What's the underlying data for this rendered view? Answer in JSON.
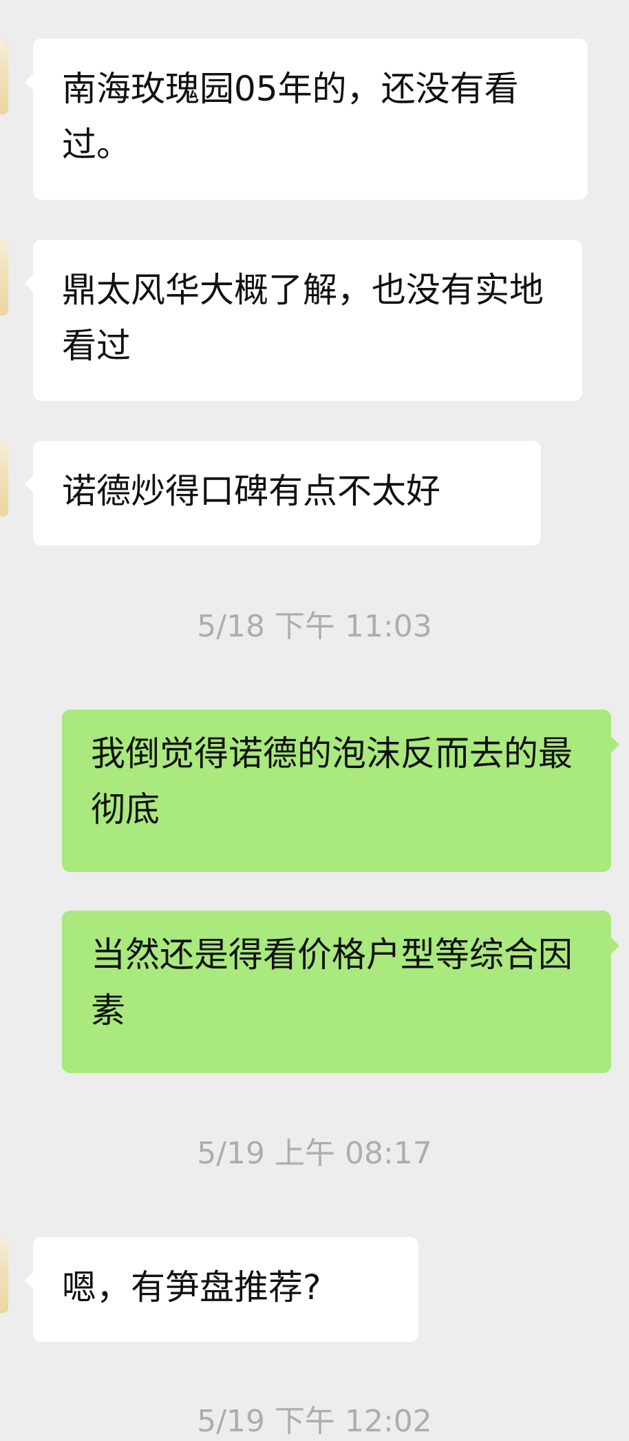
{
  "messages": [
    {
      "text": "南海玫瑰园05年的，还没有看过。"
    },
    {
      "text": "鼎太风华大概了解，也没有实地看过"
    },
    {
      "text": "诺德炒得口碑有点不太好"
    },
    {
      "time": "5/18 下午 11:03"
    },
    {
      "text": "我倒觉得诺德的泡沫反而去的最彻底"
    },
    {
      "text": "当然还是得看价格户型等综合因素"
    },
    {
      "time": "5/19 上午 08:17"
    },
    {
      "text": "嗯，有笋盘推荐?"
    },
    {
      "time": "5/19 下午 12:02"
    }
  ],
  "colors": {
    "background": "#ededed",
    "incoming_bubble": "#ffffff",
    "outgoing_bubble": "#a9e97d",
    "timestamp_text": "#adadad"
  }
}
